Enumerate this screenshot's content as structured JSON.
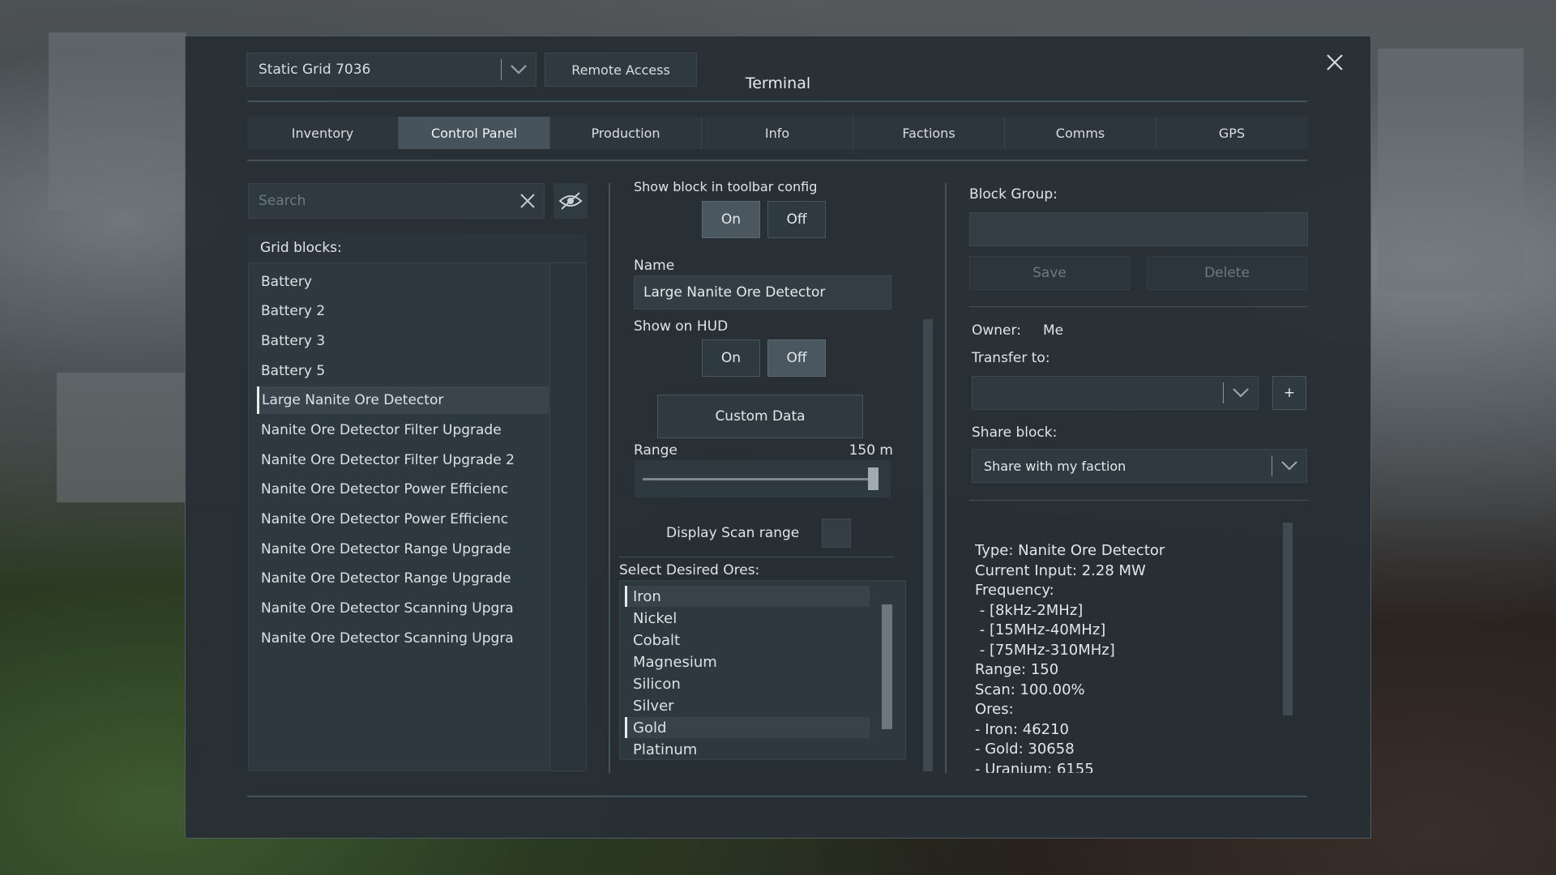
{
  "header": {
    "grid_name": "Static Grid 7036",
    "remote_access": "Remote Access",
    "title": "Terminal"
  },
  "tabs": [
    {
      "label": "Inventory",
      "active": false
    },
    {
      "label": "Control Panel",
      "active": true
    },
    {
      "label": "Production",
      "active": false
    },
    {
      "label": "Info",
      "active": false
    },
    {
      "label": "Factions",
      "active": false
    },
    {
      "label": "Comms",
      "active": false
    },
    {
      "label": "GPS",
      "active": false
    }
  ],
  "left": {
    "search_placeholder": "Search",
    "header": "Grid blocks:",
    "blocks": [
      "Battery",
      "Battery 2",
      "Battery 3",
      "Battery 5",
      "Large Nanite Ore Detector",
      "Nanite Ore Detector Filter Upgrade",
      "Nanite Ore Detector Filter Upgrade 2",
      "Nanite Ore Detector Power Efficienc",
      "Nanite Ore Detector Power Efficienc",
      "Nanite Ore Detector Range Upgrade",
      "Nanite Ore Detector Range Upgrade",
      "Nanite Ore Detector Scanning Upgra",
      "Nanite Ore Detector Scanning Upgra"
    ],
    "selected_index": 4
  },
  "middle": {
    "show_toolbar_label": "Show block in toolbar config",
    "on_label": "On",
    "off_label": "Off",
    "toolbar_state": "On",
    "name_label": "Name",
    "name_value": "Large Nanite Ore Detector",
    "show_hud_label": "Show on HUD",
    "hud_state": "Off",
    "custom_data_label": "Custom Data",
    "range_label": "Range",
    "range_value_text": "150 m",
    "range_fraction": 0.98,
    "display_scan_label": "Display Scan range",
    "display_scan_checked": false,
    "ores_label": "Select Desired Ores:",
    "ores": [
      "Iron",
      "Nickel",
      "Cobalt",
      "Magnesium",
      "Silicon",
      "Silver",
      "Gold",
      "Platinum"
    ],
    "selected_ores": [
      "Iron",
      "Gold"
    ]
  },
  "right": {
    "block_group_label": "Block Group:",
    "block_group_value": "",
    "save_label": "Save",
    "delete_label": "Delete",
    "owner_label": "Owner:",
    "owner_value": "Me",
    "transfer_label": "Transfer to:",
    "transfer_value": "",
    "add_label": "+",
    "share_label": "Share block:",
    "share_value": "Share with my faction",
    "info_lines": [
      "Type: Nanite Ore Detector",
      "Current Input: 2.28 MW",
      "Frequency:",
      " - [8kHz-2MHz]",
      " - [15MHz-40MHz]",
      " - [75MHz-310MHz]",
      "Range: 150",
      "Scan: 100.00%",
      "Ores:",
      "- Iron: 46210",
      "- Gold: 30658",
      "- Uranium: 6155"
    ]
  },
  "colors": {
    "dialog_bg": "#282f35",
    "tab_active": "#46535c",
    "text": "#d8dde2"
  }
}
